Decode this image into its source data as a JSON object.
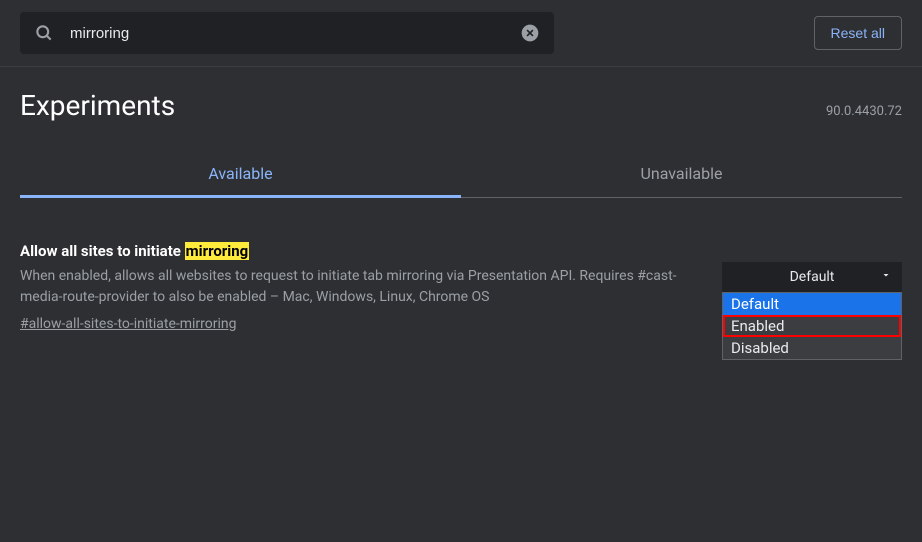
{
  "search": {
    "value": "mirroring"
  },
  "reset_label": "Reset all",
  "page_title": "Experiments",
  "version": "90.0.4430.72",
  "tabs": {
    "available": "Available",
    "unavailable": "Unavailable"
  },
  "flag": {
    "title_prefix": "Allow all sites to initiate ",
    "title_highlight": "mirroring",
    "description": "When enabled, allows all websites to request to initiate tab mirroring via Presentation API. Requires #cast-media-route-provider to also be enabled – Mac, Windows, Linux, Chrome OS",
    "link": "#allow-all-sites-to-initiate-mirroring",
    "select_value": "Default",
    "options": {
      "default": "Default",
      "enabled": "Enabled",
      "disabled": "Disabled"
    }
  }
}
